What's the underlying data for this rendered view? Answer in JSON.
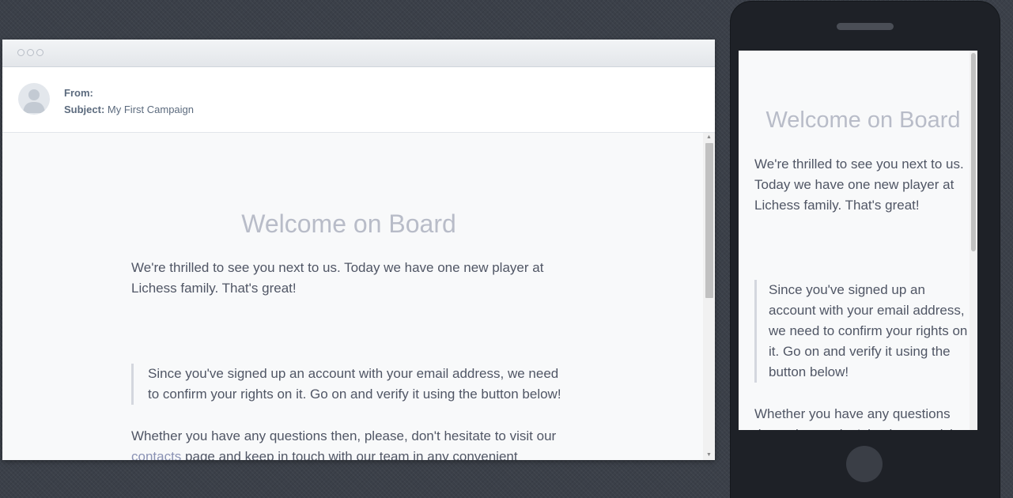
{
  "desktop": {
    "from_label": "From:",
    "from_value": "",
    "subject_label": "Subject:",
    "subject_value": "My First Campaign"
  },
  "email": {
    "heading": "Welcome on Board",
    "intro": "We're thrilled to see you next to us. Today we have one new player at Lichess family. That's great!",
    "quote": "Since you've signed up an account with your email address, we need to confirm your rights on it. Go on and verify it using the button below!",
    "closing_before_link": "Whether you have any questions then, please, don't hesitate to visit our ",
    "contacts_link": "contacts",
    "closing_after_link": " page and keep in touch with our team in any convenient manner."
  },
  "mobile": {
    "closing_visible": "Whether you have any questions then, please, don't hesitate to visit"
  }
}
